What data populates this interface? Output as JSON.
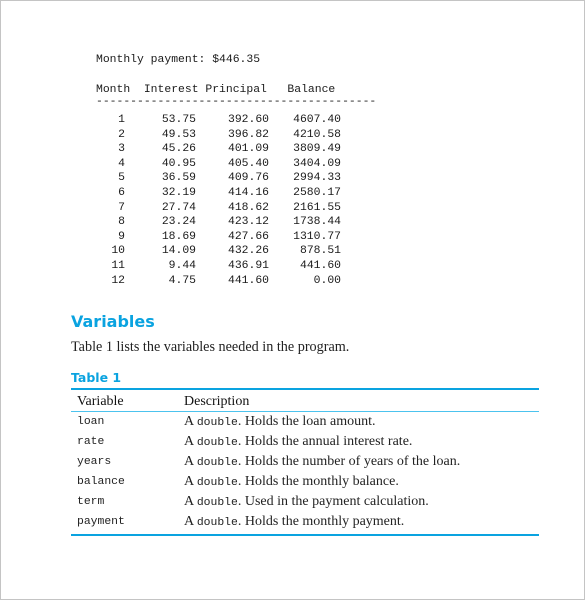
{
  "output": {
    "payment_line": "Monthly payment: $446.35",
    "columns": [
      "Month",
      "Interest",
      "Principal",
      "Balance"
    ],
    "header_line": "Month  Interest Principal   Balance",
    "rule_line": "-----------------------------------------",
    "rows": [
      {
        "month": "1",
        "interest": "53.75",
        "principal": "392.60",
        "balance": "4607.40"
      },
      {
        "month": "2",
        "interest": "49.53",
        "principal": "396.82",
        "balance": "4210.58"
      },
      {
        "month": "3",
        "interest": "45.26",
        "principal": "401.09",
        "balance": "3809.49"
      },
      {
        "month": "4",
        "interest": "40.95",
        "principal": "405.40",
        "balance": "3404.09"
      },
      {
        "month": "5",
        "interest": "36.59",
        "principal": "409.76",
        "balance": "2994.33"
      },
      {
        "month": "6",
        "interest": "32.19",
        "principal": "414.16",
        "balance": "2580.17"
      },
      {
        "month": "7",
        "interest": "27.74",
        "principal": "418.62",
        "balance": "2161.55"
      },
      {
        "month": "8",
        "interest": "23.24",
        "principal": "423.12",
        "balance": "1738.44"
      },
      {
        "month": "9",
        "interest": "18.69",
        "principal": "427.66",
        "balance": "1310.77"
      },
      {
        "month": "10",
        "interest": "14.09",
        "principal": "432.26",
        "balance": "878.51"
      },
      {
        "month": "11",
        "interest": "9.44",
        "principal": "436.91",
        "balance": "441.60"
      },
      {
        "month": "12",
        "interest": "4.75",
        "principal": "441.60",
        "balance": "0.00"
      }
    ]
  },
  "section": {
    "heading": "Variables",
    "intro": "Table 1 lists the variables needed in the program."
  },
  "table": {
    "caption": "Table 1",
    "headers": {
      "variable": "Variable",
      "description": "Description"
    },
    "rows": [
      {
        "name": "loan",
        "type_prefix": "A ",
        "type": "double",
        "text": ". Holds the loan amount."
      },
      {
        "name": "rate",
        "type_prefix": "A ",
        "type": "double",
        "text": ". Holds the annual interest rate."
      },
      {
        "name": "years",
        "type_prefix": "A ",
        "type": "double",
        "text": ". Holds the number of years of the loan."
      },
      {
        "name": "balance",
        "type_prefix": "A ",
        "type": "double",
        "text": ". Holds the monthly balance."
      },
      {
        "name": "term",
        "type_prefix": "A ",
        "type": "double",
        "text": ". Used in the payment calculation."
      },
      {
        "name": "payment",
        "type_prefix": "A ",
        "type": "double",
        "text": ". Holds the monthly payment."
      }
    ]
  },
  "colors": {
    "accent": "#0aa3e0",
    "text": "#222222",
    "page_border": "#c4c4c4"
  }
}
